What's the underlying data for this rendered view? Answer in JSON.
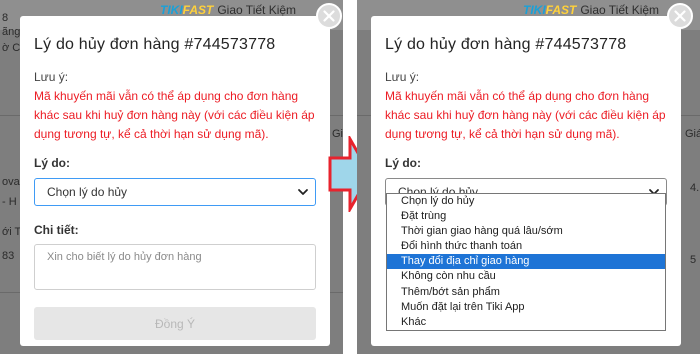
{
  "background": {
    "badge_brand_a": "TIKI",
    "badge_brand_b": "FAST",
    "badge_text": "Giao Tiết Kiệm",
    "left_snippets": [
      "8",
      "ãng, X",
      "ờ Chí M",
      "ova",
      "- H",
      "ới T",
      "83",
      "Giá"
    ],
    "right_snippets": [
      "Giá",
      "4.",
      "5"
    ]
  },
  "dialog": {
    "title": "Lý do hủy đơn hàng #744573778",
    "note_label": "Lưu ý:",
    "note_text": "Mã khuyến mãi vẫn có thể áp dụng cho đơn hàng khác sau khi huỷ đơn hàng này (với các điều kiện áp dụng tương tự, kể cả thời hạn sử dụng mã).",
    "reason_label": "Lý do:",
    "reason_select_value": "Chọn lý do hủy",
    "detail_label": "Chi tiết:",
    "detail_placeholder": "Xin cho biết lý do hủy đơn hàng",
    "submit_label": "Đồng Ý",
    "close_icon": "close-icon"
  },
  "dropdown": {
    "options": [
      "Chọn lý do hủy",
      "Đặt trùng",
      "Thời gian giao hàng quá lâu/sớm",
      "Đổi hình thức thanh toán",
      "Thay đổi địa chỉ giao hàng",
      "Không còn nhu cầu",
      "Thêm/bớt sản phẩm",
      "Muốn đặt lại trên Tiki App",
      "Khác"
    ],
    "highlighted_index": 4
  },
  "colors": {
    "note_red": "#ec1c24",
    "focus_blue": "#3f9bf5",
    "highlight_blue": "#1e74d6",
    "arrow_red": "#e8232d",
    "arrow_fill": "#9fd6ea",
    "overlay": "#7e7e7e"
  }
}
